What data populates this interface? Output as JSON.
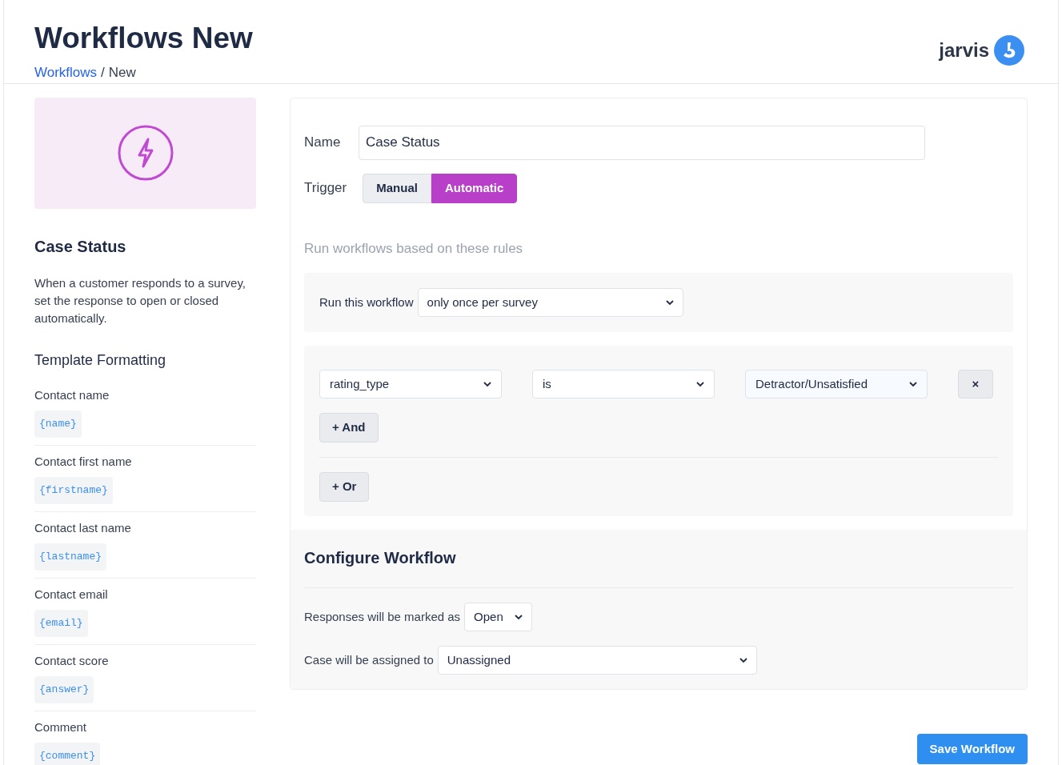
{
  "header": {
    "title": "Workflows New",
    "breadcrumb_separator": "/",
    "breadcrumb": [
      {
        "label": "Workflows",
        "link": true
      },
      {
        "label": "New",
        "link": false
      }
    ],
    "logo_text": "jarvis"
  },
  "template": {
    "title": "Case Status",
    "description": "When a customer responds to a survey, set the response to open or closed automatically.",
    "formatting_title": "Template Formatting",
    "variables": [
      {
        "label": "Contact name",
        "code": "{name}"
      },
      {
        "label": "Contact first name",
        "code": "{firstname}"
      },
      {
        "label": "Contact last name",
        "code": "{lastname}"
      },
      {
        "label": "Contact email",
        "code": "{email}"
      },
      {
        "label": "Contact score",
        "code": "{answer}"
      },
      {
        "label": "Comment",
        "code": "{comment}"
      }
    ]
  },
  "form": {
    "name_label": "Name",
    "name_value": "Case Status",
    "trigger_label": "Trigger",
    "trigger_options": [
      {
        "label": "Manual",
        "selected": false
      },
      {
        "label": "Automatic",
        "selected": true
      }
    ],
    "rules_heading": "Run workflows based on these rules",
    "run_label": "Run this workflow",
    "run_value": "only once per survey",
    "conditions": [
      {
        "field": "rating_type",
        "operator": "is",
        "value": "Detractor/Unsatisfied",
        "remove": "×"
      }
    ],
    "and_button": "+ And",
    "or_button": "+ Or",
    "configure_title": "Configure Workflow",
    "marked_label": "Responses will be marked as",
    "marked_value": "Open",
    "assigned_label": "Case will be assigned to",
    "assigned_value": "Unassigned"
  },
  "save_button": "Save Workflow"
}
